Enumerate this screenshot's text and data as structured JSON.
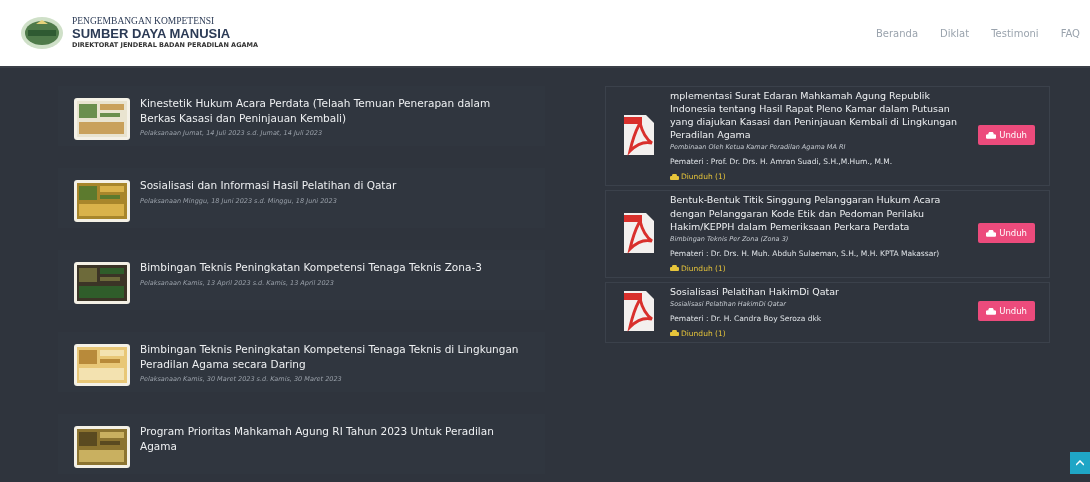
{
  "header": {
    "logo_lines": [
      "PENGEMBANGAN KOMPETENSI",
      "SUMBER DAYA MANUSIA",
      "DIREKTORAT JENDERAL BADAN PERADILAN AGAMA"
    ],
    "nav": [
      {
        "label": "Beranda"
      },
      {
        "label": "Diklat"
      },
      {
        "label": "Testimoni"
      },
      {
        "label": "FAQ"
      }
    ]
  },
  "trainings": [
    {
      "title": "Kinestetik Hukum Acara Perdata (Telaah Temuan Penerapan dalam Berkas Kasasi dan Peninjauan Kembali)",
      "date": "Pelaksanaan Jumat, 14 Juli 2023 s.d. Jumat, 14 Juli 2023"
    },
    {
      "title": "Sosialisasi dan Informasi Hasil Pelatihan di Qatar",
      "date": "Pelaksanaan Minggu, 18 Juni 2023 s.d. Minggu, 18 Juni 2023"
    },
    {
      "title": "Bimbingan Teknis Peningkatan Kompetensi Tenaga Teknis Zona-3",
      "date": "Pelaksanaan Kamis, 13 April 2023 s.d. Kamis, 13 April 2023"
    },
    {
      "title": "Bimbingan Teknis Peningkatan Kompetensi Tenaga Teknis di Lingkungan Peradilan Agama secara Daring",
      "date": "Pelaksanaan Kamis, 30 Maret 2023 s.d. Kamis, 30 Maret 2023"
    },
    {
      "title": "Program Prioritas Mahkamah Agung RI Tahun 2023 Untuk Peradilan Agama"
    }
  ],
  "materials": [
    {
      "title": "mplementasi Surat Edaran Mahkamah Agung Republik Indonesia tentang Hasil Rapat Pleno Kamar dalam Putusan yang diajukan Kasasi dan Peninjauan Kembali di Lingkungan Peradilan Agama",
      "subtitle": "Pembinaan Oleh Ketua Kamar Peradilan Agama MA RI",
      "speaker": "Pemateri : Prof. Dr. Drs. H. Amran Suadi, S.H.,M.Hum., M.M.",
      "downloads": "Diunduh (1)",
      "button": "Unduh"
    },
    {
      "title": "Bentuk-Bentuk Titik Singgung Pelanggaran Hukum Acara dengan Pelanggaran Kode Etik dan Pedoman Perilaku Hakim/KEPPH dalam Pemeriksaan Perkara Perdata",
      "subtitle": "Bimbingan Teknis Per Zona (Zona 3)",
      "speaker": "Pemateri : Dr. Drs. H. Muh. Abduh Sulaeman, S.H., M.H. KPTA Makassar)",
      "downloads": "Diunduh (1)",
      "button": "Unduh"
    },
    {
      "title": "Sosialisasi Pelatihan HakimDi Qatar",
      "subtitle": "Sosialisasi Pelatihan HakimDi Qatar",
      "speaker": "Pemateri : Dr. H. Candra Boy Seroza dkk",
      "downloads": "Diunduh (1)",
      "button": "Unduh"
    }
  ]
}
